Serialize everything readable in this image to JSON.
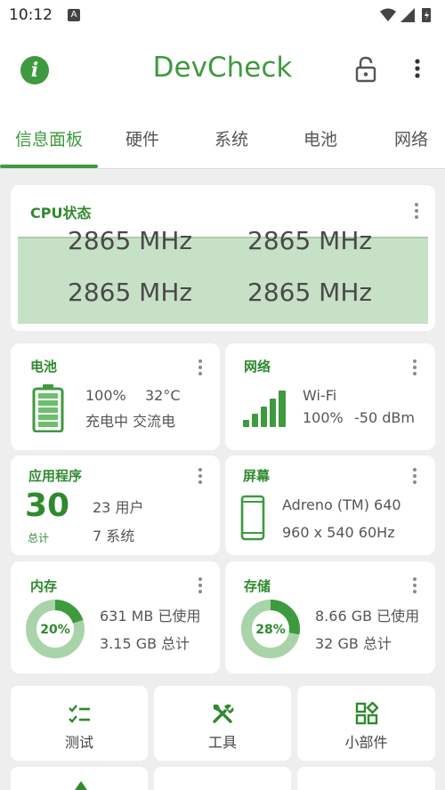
{
  "status_bar": {
    "time": "10:12",
    "notif": "A"
  },
  "app": {
    "title": "DevCheck",
    "accent": "#3e9a3e"
  },
  "tabs": [
    {
      "label": "信息面板",
      "active": true
    },
    {
      "label": "硬件"
    },
    {
      "label": "系统"
    },
    {
      "label": "电池"
    },
    {
      "label": "网络"
    }
  ],
  "cpu": {
    "title": "CPU状态",
    "cores": [
      "2865 MHz",
      "2865 MHz",
      "2865 MHz",
      "2865 MHz"
    ]
  },
  "battery": {
    "title": "电池",
    "level": "100%",
    "temp": "32°C",
    "status": "充电中 交流电"
  },
  "network": {
    "title": "网络",
    "type": "Wi-Fi",
    "strength": "100%",
    "dbm": "-50 dBm"
  },
  "apps": {
    "title": "应用程序",
    "total": "30",
    "total_label": "总计",
    "user": "23 用户",
    "system": "7 系统"
  },
  "screen": {
    "title": "屏幕",
    "gpu": "Adreno (TM) 640",
    "resolution": "960 x 540  60Hz"
  },
  "memory": {
    "title": "内存",
    "percent": "20%",
    "percent_value": 20,
    "used": "631 MB 已使用",
    "total": "3.15 GB 总计"
  },
  "storage": {
    "title": "存储",
    "percent": "28%",
    "percent_value": 28,
    "used": "8.66 GB 已使用",
    "total": "32 GB 总计"
  },
  "buttons": [
    {
      "label": "测试",
      "icon": "checklist-icon"
    },
    {
      "label": "工具",
      "icon": "tools-icon"
    },
    {
      "label": "小部件",
      "icon": "widgets-icon"
    }
  ]
}
